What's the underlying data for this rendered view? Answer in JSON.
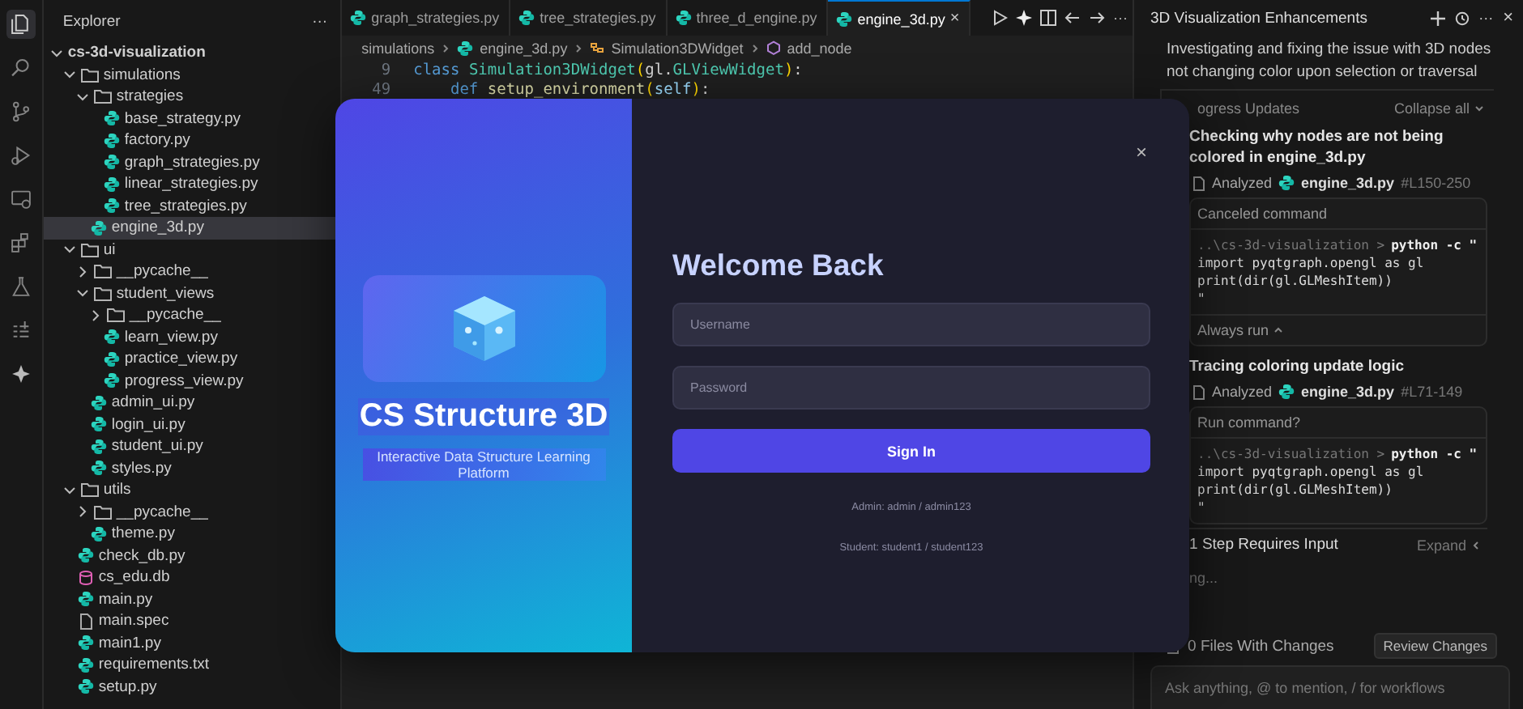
{
  "activity_bar": [
    {
      "kind": "files",
      "selected": true
    },
    {
      "kind": "search",
      "selected": false
    },
    {
      "kind": "branch",
      "selected": false
    },
    {
      "kind": "run",
      "selected": false
    },
    {
      "kind": "remote",
      "selected": false
    },
    {
      "kind": "extensions",
      "selected": false
    },
    {
      "kind": "flask",
      "selected": false
    },
    {
      "kind": "list",
      "selected": false
    },
    {
      "kind": "sparkle",
      "selected": false
    }
  ],
  "explorer": {
    "title": "Explorer",
    "more": "···",
    "tree": [
      {
        "label": "cs-3d-visualization",
        "kind": "root",
        "expanded": true,
        "selected": false,
        "children": [
          {
            "label": "simulations",
            "kind": "folder",
            "expanded": true,
            "selected": false,
            "children": [
              {
                "label": "strategies",
                "kind": "folder",
                "expanded": true,
                "selected": false,
                "children": [
                  {
                    "label": "base_strategy.py",
                    "kind": "python",
                    "selected": false
                  },
                  {
                    "label": "factory.py",
                    "kind": "python",
                    "selected": false
                  },
                  {
                    "label": "graph_strategies.py",
                    "kind": "python",
                    "selected": false
                  },
                  {
                    "label": "linear_strategies.py",
                    "kind": "python",
                    "selected": false
                  },
                  {
                    "label": "tree_strategies.py",
                    "kind": "python",
                    "selected": false
                  }
                ]
              },
              {
                "label": "engine_3d.py",
                "kind": "python",
                "selected": true
              }
            ]
          },
          {
            "label": "ui",
            "kind": "folder",
            "expanded": true,
            "selected": false,
            "children": [
              {
                "label": "__pycache__",
                "kind": "folder",
                "expanded": false,
                "selected": false
              },
              {
                "label": "student_views",
                "kind": "folder",
                "expanded": true,
                "selected": false,
                "children": [
                  {
                    "label": "__pycache__",
                    "kind": "folder",
                    "expanded": false,
                    "selected": false
                  },
                  {
                    "label": "learn_view.py",
                    "kind": "python",
                    "selected": false
                  },
                  {
                    "label": "practice_view.py",
                    "kind": "python",
                    "selected": false
                  },
                  {
                    "label": "progress_view.py",
                    "kind": "python",
                    "selected": false
                  }
                ]
              },
              {
                "label": "admin_ui.py",
                "kind": "python",
                "selected": false
              },
              {
                "label": "login_ui.py",
                "kind": "python",
                "selected": false
              },
              {
                "label": "student_ui.py",
                "kind": "python",
                "selected": false
              },
              {
                "label": "styles.py",
                "kind": "python",
                "selected": false
              }
            ]
          },
          {
            "label": "utils",
            "kind": "folder",
            "expanded": true,
            "selected": false,
            "children": [
              {
                "label": "__pycache__",
                "kind": "folder",
                "expanded": false,
                "selected": false
              },
              {
                "label": "theme.py",
                "kind": "python",
                "selected": false
              }
            ]
          },
          {
            "label": "check_db.py",
            "kind": "python",
            "selected": false
          },
          {
            "label": "cs_edu.db",
            "kind": "database",
            "selected": false
          },
          {
            "label": "main.py",
            "kind": "python",
            "selected": false
          },
          {
            "label": "main.spec",
            "kind": "file",
            "selected": false
          },
          {
            "label": "main1.py",
            "kind": "python",
            "selected": false
          },
          {
            "label": "requirements.txt",
            "kind": "python",
            "selected": false
          },
          {
            "label": "setup.py",
            "kind": "python",
            "selected": false
          }
        ]
      }
    ]
  },
  "editor": {
    "tabs": [
      {
        "label": "graph_strategies.py",
        "selected": false
      },
      {
        "label": "tree_strategies.py",
        "selected": false
      },
      {
        "label": "three_d_engine.py",
        "selected": false
      },
      {
        "label": "engine_3d.py",
        "selected": true,
        "close": "×"
      }
    ],
    "more": "···",
    "breadcrumb": [
      {
        "label": "simulations",
        "kind": "folder"
      },
      {
        "label": "engine_3d.py",
        "kind": "python"
      },
      {
        "label": "Simulation3DWidget",
        "kind": "class"
      },
      {
        "label": "add_node",
        "kind": "method"
      }
    ],
    "lines": [
      {
        "number": "9",
        "tokens": [
          {
            "kind": "keyword",
            "text": "class "
          },
          {
            "kind": "type",
            "text": "Simulation3DWidget"
          },
          {
            "kind": "paren",
            "text": "("
          },
          {
            "kind": "plain",
            "text": "gl."
          },
          {
            "kind": "type",
            "text": "GLViewWidget"
          },
          {
            "kind": "paren",
            "text": ")"
          },
          {
            "kind": "plain",
            "text": ":"
          }
        ]
      },
      {
        "number": "49",
        "tokens": [
          {
            "kind": "keyword",
            "text": "    def "
          },
          {
            "kind": "function",
            "text": "setup_environment"
          },
          {
            "kind": "paren",
            "text": "("
          },
          {
            "kind": "param",
            "text": "self"
          },
          {
            "kind": "paren",
            "text": ")"
          },
          {
            "kind": "plain",
            "text": ":"
          }
        ]
      }
    ]
  },
  "login_dialog": {
    "close": "×",
    "brand": {
      "title": "CS Structure 3D",
      "subtitle": "Interactive Data Structure Learning Platform"
    },
    "heading": "Welcome Back",
    "fields": [
      {
        "placeholder": "Username"
      },
      {
        "placeholder": "Password"
      }
    ],
    "button": "Sign In",
    "hints": [
      "Admin: admin / admin123",
      "Student: student1 / student123"
    ]
  },
  "agent_panel": {
    "title": "3D Visualization Enhancements",
    "more": "···",
    "close": "×",
    "summary": "Investigating and fixing the issue with 3D nodes not changing color upon selection or traversal",
    "progress_label": "ogress Updates",
    "collapse": "Collapse all",
    "steps": [
      {
        "title": "Checking why nodes are not being colored in engine_3d.py",
        "analyzed": "Analyzed",
        "file": "engine_3d.py",
        "range": "#L150-250",
        "command": {
          "status": "Canceled command",
          "prompt": "..\\cs-3d-visualization >",
          "command": "python -c \"",
          "lines": [
            "import pyqtgraph.opengl as gl",
            "print(dir(gl.GLMeshItem))",
            "\""
          ],
          "footer": "Always run"
        }
      },
      {
        "title": "Tracing coloring update logic",
        "analyzed": "Analyzed",
        "file": "engine_3d.py",
        "range": "#L71-149",
        "command": {
          "status": "Run command?",
          "prompt": "..\\cs-3d-visualization >",
          "command": "python -c \"",
          "lines": [
            "import pyqtgraph.opengl as gl",
            "print(dir(gl.GLMeshItem))",
            "\""
          ]
        }
      }
    ],
    "requires": "1 Step Requires Input",
    "expand": "Expand",
    "thinking": "ng...",
    "files": "0 Files With Changes",
    "review": "Review Changes",
    "input": {
      "placeholder": "Ask anything, @ to mention, / for workflows"
    }
  }
}
